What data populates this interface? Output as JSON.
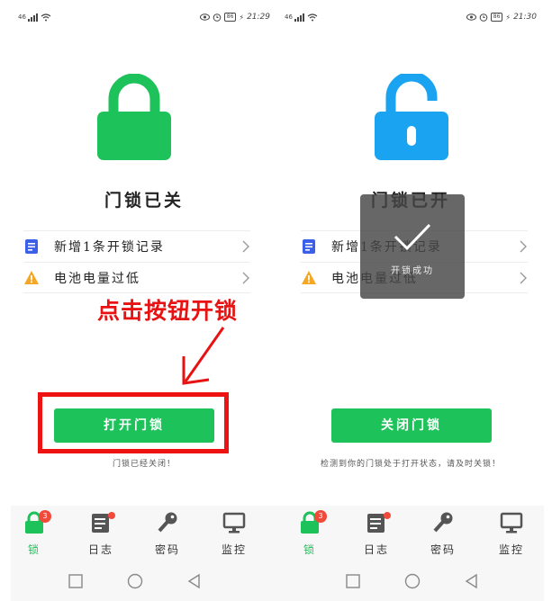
{
  "colors": {
    "accent_green": "#1ec25a",
    "unlock_blue": "#1aa3f0",
    "annotation_red": "#e81212",
    "badge_red": "#f04a3a"
  },
  "left": {
    "status": {
      "carrier": "46",
      "battery": "86",
      "time": "21:29"
    },
    "lock_state_icon": "locked-padlock-icon",
    "lock_title": "门锁已关",
    "menu": [
      {
        "icon": "document-icon",
        "label": "新增1条开锁记录"
      },
      {
        "icon": "warning-icon",
        "label": "电池电量过低"
      }
    ],
    "annotation": "点击按钮开锁",
    "button_label": "打开门锁",
    "hint": "门锁已经关闭！",
    "tabs": [
      {
        "icon": "lock-tab-icon",
        "label": "锁",
        "badge": "3"
      },
      {
        "icon": "log-tab-icon",
        "label": "日志"
      },
      {
        "icon": "key-tab-icon",
        "label": "密码"
      },
      {
        "icon": "monitor-tab-icon",
        "label": "监控"
      }
    ]
  },
  "right": {
    "status": {
      "carrier": "46",
      "battery": "86",
      "time": "21:30"
    },
    "lock_state_icon": "unlocked-padlock-icon",
    "lock_title": "门锁已开",
    "menu": [
      {
        "icon": "document-icon",
        "label": "新增1条开锁记录"
      },
      {
        "icon": "warning-icon",
        "label": "电池电量过低"
      }
    ],
    "toast": "开锁成功",
    "button_label": "关闭门锁",
    "hint": "检测到你的门锁处于打开状态，请及时关锁！",
    "tabs": [
      {
        "icon": "lock-tab-icon",
        "label": "锁",
        "badge": "3"
      },
      {
        "icon": "log-tab-icon",
        "label": "日志"
      },
      {
        "icon": "key-tab-icon",
        "label": "密码"
      },
      {
        "icon": "monitor-tab-icon",
        "label": "监控"
      }
    ]
  },
  "navbar": {
    "icons": [
      "recent-apps-icon",
      "home-icon",
      "back-icon"
    ]
  }
}
